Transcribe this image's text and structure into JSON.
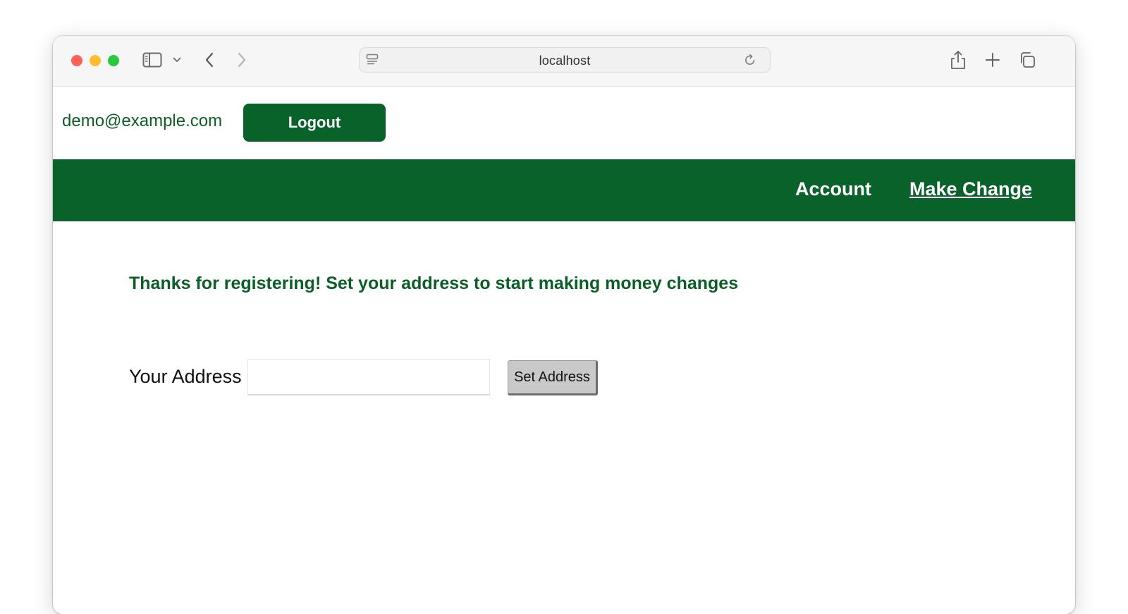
{
  "browser": {
    "url": "localhost",
    "icons": {
      "sidebar": "sidebar-icon",
      "sidebar_menu": "chevron-down-icon",
      "back": "chevron-left-icon",
      "forward": "chevron-right-icon",
      "site_settings": "page-settings-icon",
      "reload": "reload-icon",
      "share": "share-icon",
      "new_tab": "plus-icon",
      "tabs": "tabs-overview-icon"
    }
  },
  "header": {
    "user_email": "demo@example.com",
    "logout_label": "Logout"
  },
  "nav": {
    "account_label": "Account",
    "make_change_label": "Make Change"
  },
  "main": {
    "message": "Thanks for registering! Set your address to start making money changes",
    "address_label": "Your Address",
    "address_value": "",
    "set_address_label": "Set Address"
  },
  "colors": {
    "brand_green": "#09622a",
    "text_green": "#0b5e26",
    "button_gray": "#c9c9c9"
  }
}
